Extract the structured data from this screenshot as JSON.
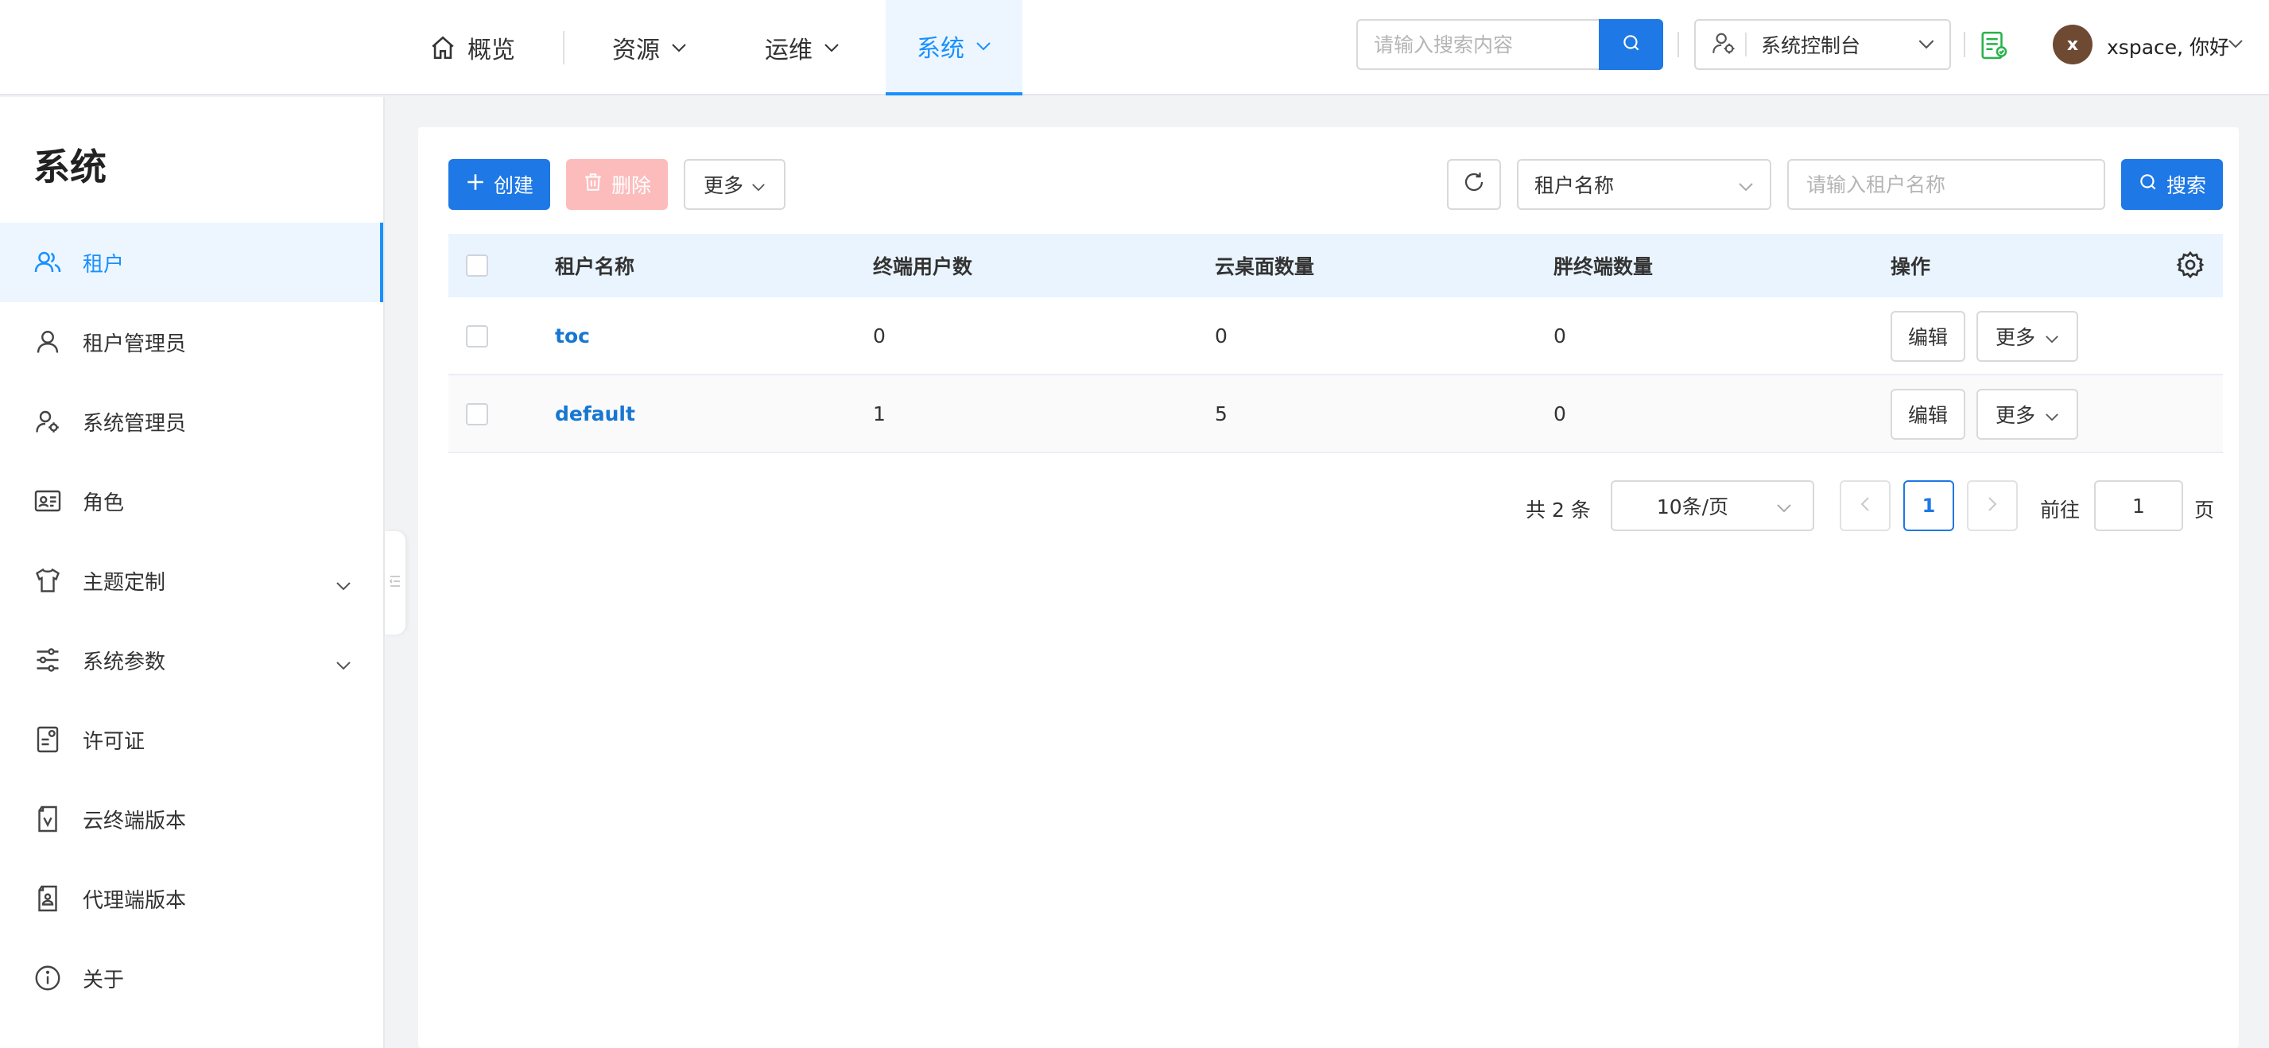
{
  "topnav": {
    "overview_label": "概览",
    "resources_label": "资源",
    "ops_label": "运维",
    "system_label": "系统",
    "search_placeholder": "请输入搜索内容",
    "console_label": "系统控制台",
    "avatar_initial": "x",
    "user_greeting": "xspace, 你好"
  },
  "sidebar": {
    "title": "系统",
    "items": [
      {
        "label": "租户",
        "icon": "users-icon"
      },
      {
        "label": "租户管理员",
        "icon": "user-icon"
      },
      {
        "label": "系统管理员",
        "icon": "user-gear-icon"
      },
      {
        "label": "角色",
        "icon": "id-card-icon"
      },
      {
        "label": "主题定制",
        "icon": "shirt-icon"
      },
      {
        "label": "系统参数",
        "icon": "sliders-icon"
      },
      {
        "label": "许可证",
        "icon": "license-icon"
      },
      {
        "label": "云终端版本",
        "icon": "cloud-terminal-version-icon"
      },
      {
        "label": "代理端版本",
        "icon": "agent-version-icon"
      },
      {
        "label": "关于",
        "icon": "info-icon"
      }
    ]
  },
  "toolbar": {
    "create_label": "创建",
    "delete_label": "删除",
    "more_label": "更多",
    "filter_field": "租户名称",
    "filter_placeholder": "请输入租户名称",
    "search_label": "搜索"
  },
  "table": {
    "columns": [
      "租户名称",
      "终端用户数",
      "云桌面数量",
      "胖终端数量",
      "操作"
    ],
    "rows": [
      {
        "name": "toc",
        "users": "0",
        "desktops": "0",
        "fat_terminals": "0"
      },
      {
        "name": "default",
        "users": "1",
        "desktops": "5",
        "fat_terminals": "0"
      }
    ],
    "edit_label": "编辑",
    "more_label": "更多"
  },
  "pagination": {
    "total_text": "共 2 条",
    "page_size": "10条/页",
    "current_page": "1",
    "goto_label": "前往",
    "goto_value": "1",
    "page_suffix": "页"
  },
  "colors": {
    "primary": "#1e78e6",
    "active_bg": "#edf6ff",
    "delete_disabled": "#fcbcbc",
    "license_icon": "#27b34a",
    "avatar_bg": "#6e4a33"
  }
}
